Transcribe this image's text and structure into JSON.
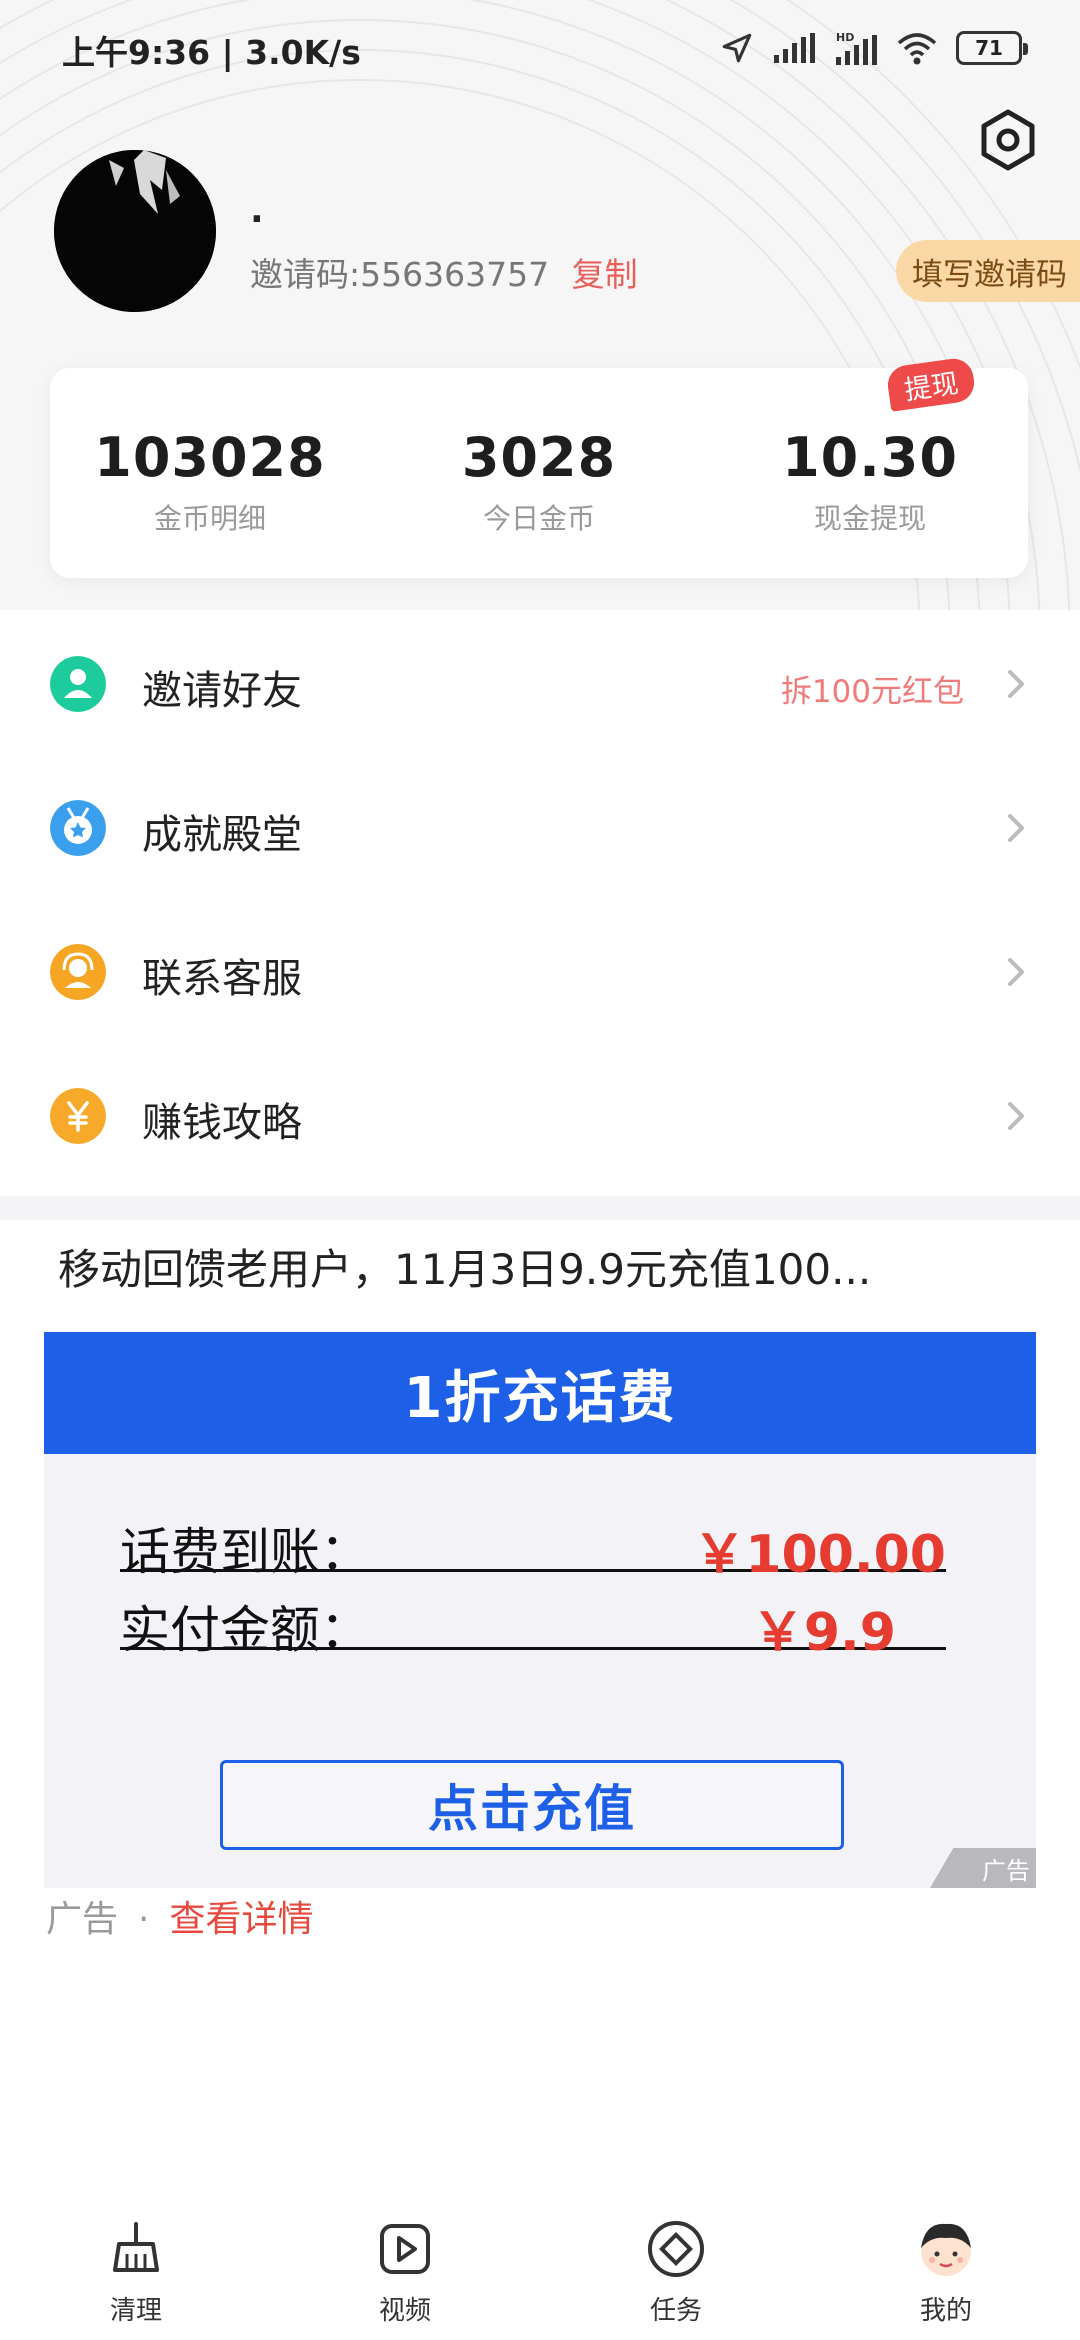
{
  "status_bar": {
    "time_speed": "上午9:36 | 3.0K/s",
    "battery": "71",
    "icons": [
      "location-arrow-icon",
      "signal-icon",
      "hd-signal-icon",
      "wifi-icon",
      "battery-icon"
    ]
  },
  "profile": {
    "nickname": ".",
    "invite_code_text": "邀请码:556363757",
    "copy_label": "复制",
    "fill_invite_label": "填写邀请码"
  },
  "stats": [
    {
      "value": "103028",
      "label": "金币明细"
    },
    {
      "value": "3028",
      "label": "今日金币"
    },
    {
      "value": "10.30",
      "label": "现金提现"
    }
  ],
  "withdraw_badge": "提现",
  "menu": [
    {
      "label": "邀请好友",
      "extra": "拆100元红包",
      "icon": "user-icon",
      "color": "#1ccc9c"
    },
    {
      "label": "成就殿堂",
      "extra": "",
      "icon": "medal-icon",
      "color": "#3aa0ee"
    },
    {
      "label": "联系客服",
      "extra": "",
      "icon": "headset-icon",
      "color": "#f6a623"
    },
    {
      "label": "赚钱攻略",
      "extra": "",
      "icon": "yen-icon",
      "color": "#f7a92a"
    }
  ],
  "ad": {
    "title": "移动回馈老用户，11月3日9.9元充值100...",
    "banner": "1折充话费",
    "row1_label": "话费到账：",
    "row1_value": "￥100.00",
    "row2_label": "实付金额：",
    "row2_value": "￥9.9",
    "button": "点击充值",
    "corner_label": "广告",
    "footer_ad": "广告",
    "footer_dot": "·",
    "footer_link": "查看详情"
  },
  "tabs": [
    {
      "label": "清理",
      "icon": "broom-icon"
    },
    {
      "label": "视频",
      "icon": "play-icon"
    },
    {
      "label": "任务",
      "icon": "diamond-icon"
    },
    {
      "label": "我的",
      "icon": "profile-face-icon"
    }
  ],
  "colors": {
    "accent_red": "#e53b30",
    "ad_blue": "#1d5fe6",
    "invite_button_bg": "#fad8a6"
  }
}
